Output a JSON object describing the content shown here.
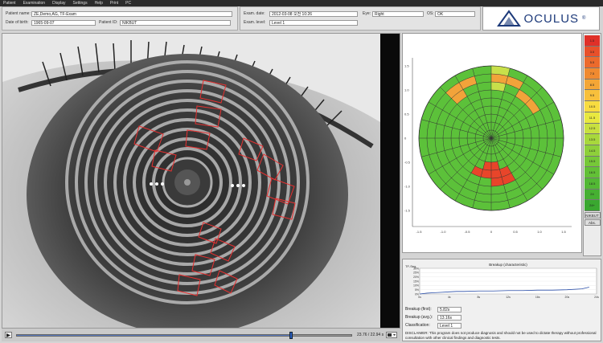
{
  "menu": [
    "Patient",
    "Examination",
    "Display",
    "Settings",
    "Help",
    "Print",
    "PC"
  ],
  "patient": {
    "name_label": "Patient name:",
    "name_value": "ZE,Demo,AG, TF-Exam",
    "dob_label": "Date of birth:",
    "dob_value": "1965-09-07",
    "id_label": "Patient ID:",
    "id_value": "NIKBUT"
  },
  "exam": {
    "date_label": "Exam. date:",
    "date_value": "2012-03-08 오전 10:26",
    "eye_label": "Eye:",
    "eye_value": "Right",
    "os_label": "OS:",
    "os_value": "OK",
    "level_label": "Exam. level:",
    "level_value": "Level 1"
  },
  "logo": {
    "text": "OCULUS",
    "registered": "®"
  },
  "playback": {
    "time": "23.76 / 22.94 s",
    "progress": 0.82
  },
  "map": {
    "left_ticks": [
      "1.5",
      "1.0",
      "0.5",
      "0",
      "-0.5",
      "-1.0",
      "-1.5"
    ],
    "bottom_ticks": [
      "-1.5",
      "-1.0",
      "-0.5",
      "0",
      "0.5",
      "1.0",
      "1.5"
    ],
    "colors": {
      "green": "#5cc13a",
      "orange": "#f2a33a",
      "red": "#e8452a",
      "yellowgreen": "#c8e04a"
    }
  },
  "scale": {
    "values": [
      "1.5",
      "3.5",
      "5.5",
      "7.5",
      "8.5",
      "9.5",
      "10.5",
      "11.5",
      "12.5",
      "13.5",
      "14.5",
      "15.5",
      "16.5",
      "18.5",
      "24",
      "24+"
    ],
    "colors": [
      "#e03028",
      "#e8502a",
      "#ec6a2c",
      "#f08a30",
      "#f4a636",
      "#f8c03c",
      "#f8dc40",
      "#e8e840",
      "#c8e040",
      "#a8d83c",
      "#8ed03a",
      "#76c838",
      "#62c036",
      "#52b834",
      "#46b032",
      "#3aa830"
    ],
    "unit_button": "NIKBUT",
    "abs_button": "Abs."
  },
  "breakup": {
    "chart_title": "Breakup (characteristic)",
    "series_label": "TF-Seg",
    "y_ticks": [
      "30%",
      "25%",
      "20%",
      "15%",
      "10%",
      "5%",
      "0%"
    ],
    "x_ticks": [
      "0s",
      "4s",
      "8s",
      "12s",
      "16s",
      "20s",
      "24s"
    ],
    "first_label": "Breakup (first):",
    "first_value": "5.82s",
    "avg_label": "Breakup (avg.):",
    "avg_value": "13.16s",
    "class_label": "Classification:",
    "class_value": "Level 1",
    "disclaimer": "DISCLAIMER: This program does not produce diagnosis and should not be used to dictate therapy without professional consultation with other clinical findings and diagnostic tests."
  },
  "chart_data": {
    "type": "line",
    "title": "Breakup (characteristic)",
    "ylabel": "TF-Seg",
    "x": [
      0,
      1,
      2,
      3,
      4,
      5,
      6,
      8,
      10,
      12,
      14,
      16,
      18,
      20,
      22,
      23
    ],
    "y": [
      0,
      1,
      1.5,
      2,
      2.5,
      3,
      3,
      3.5,
      3.5,
      4,
      4,
      4.5,
      4.5,
      5,
      6,
      8
    ],
    "xlim": [
      0,
      24
    ],
    "ylim": [
      0,
      30
    ]
  }
}
